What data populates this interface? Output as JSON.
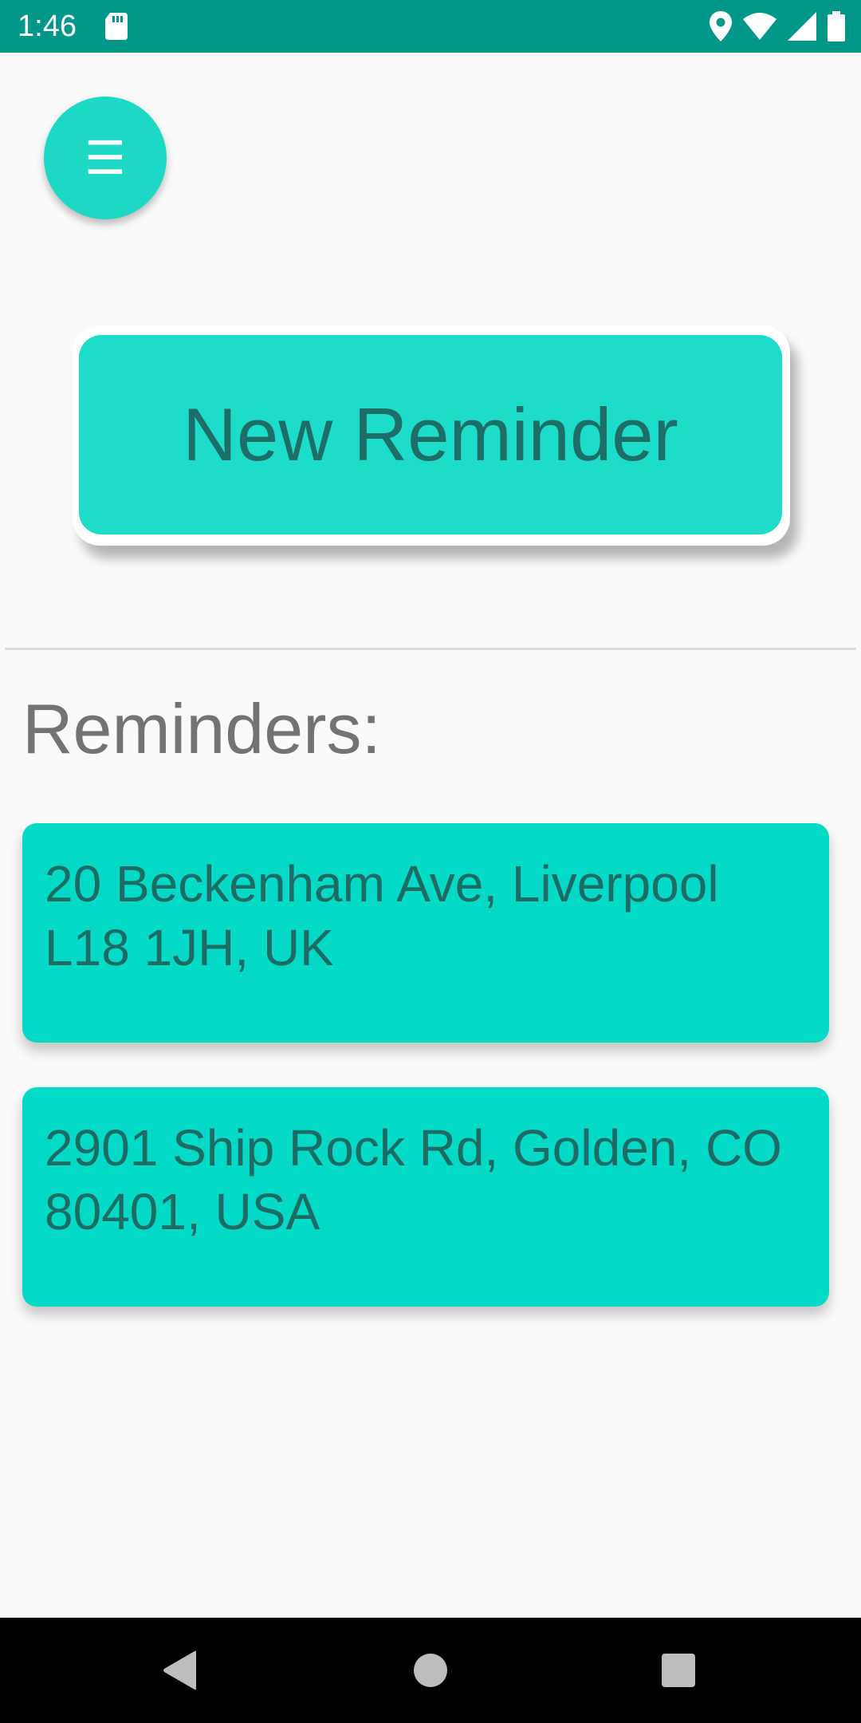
{
  "status_bar": {
    "time": "1:46",
    "icons": [
      "sd-card-icon",
      "location-icon",
      "wifi-icon",
      "signal-icon",
      "battery-icon"
    ],
    "background_color": "#00968A"
  },
  "menu_button": {
    "icon": "menu-icon",
    "glyph": "☰",
    "color": "#1CD9C6"
  },
  "new_reminder_button": {
    "label": "New Reminder",
    "color": "#1DDDC8",
    "text_color": "#1E6E68"
  },
  "reminders_section": {
    "title": "Reminders:",
    "items": [
      {
        "text": "20 Beckenham Ave, Liverpool\nL18 1JH, UK"
      },
      {
        "text": "2901 Ship Rock Rd, Golden, CO\n80401, USA"
      }
    ],
    "card_color": "#03D9C5"
  },
  "nav_bar": {
    "buttons": [
      "back-icon",
      "home-icon",
      "recents-icon"
    ]
  }
}
